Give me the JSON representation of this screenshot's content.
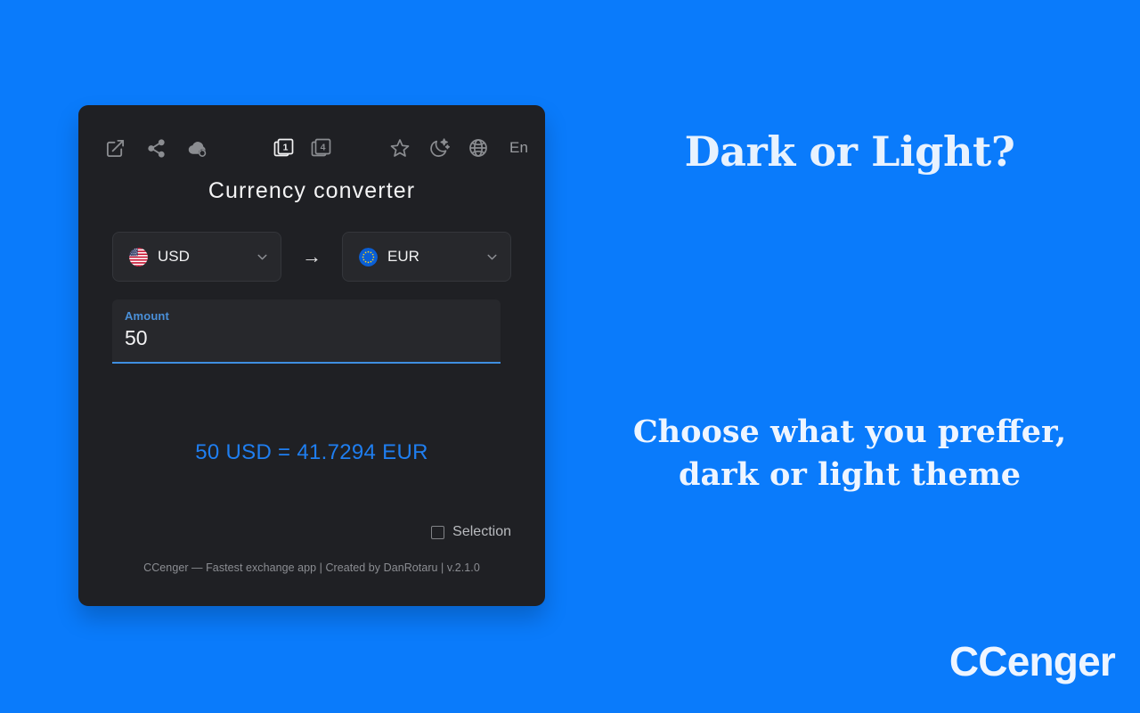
{
  "background_color": "#0a7bfb",
  "app": {
    "card_color": "#1f2024",
    "title": "Currency converter",
    "toolbar": {
      "left_icons": [
        {
          "name": "external-link-icon",
          "label": "Open in new window"
        },
        {
          "name": "share-icon",
          "label": "Share"
        },
        {
          "name": "cloud-sync-icon",
          "label": "Cloud sync"
        }
      ],
      "mid_icons": [
        {
          "name": "cards-one-icon",
          "label": "1",
          "active": true
        },
        {
          "name": "cards-four-icon",
          "label": "4",
          "active": false
        }
      ],
      "right_icons": [
        {
          "name": "star-icon",
          "label": "Favorite"
        },
        {
          "name": "moon-stars-icon",
          "label": "Dark mode"
        },
        {
          "name": "globe-icon",
          "label": "Language"
        }
      ],
      "language_code": "En"
    },
    "converter": {
      "from": {
        "code": "USD",
        "flag": "us-flag-icon"
      },
      "to": {
        "code": "EUR",
        "flag": "eu-flag-icon"
      },
      "swap_arrow": "→",
      "amount": {
        "label": "Amount",
        "value": "50",
        "placeholder": "Amount",
        "accent_color": "#3f8ee0"
      },
      "result": "50 USD = 41.7294 EUR",
      "result_color": "#1f7ef0"
    },
    "selection": {
      "label": "Selection",
      "checked": false
    },
    "footer": "CCenger — Fastest exchange app | Created by DanRotaru | v.2.1.0"
  },
  "promo": {
    "heading": "Dark or Light?",
    "subtitle_line1": "Choose what you preffer,",
    "subtitle_line2": "dark or light theme",
    "brand": "CCenger"
  }
}
